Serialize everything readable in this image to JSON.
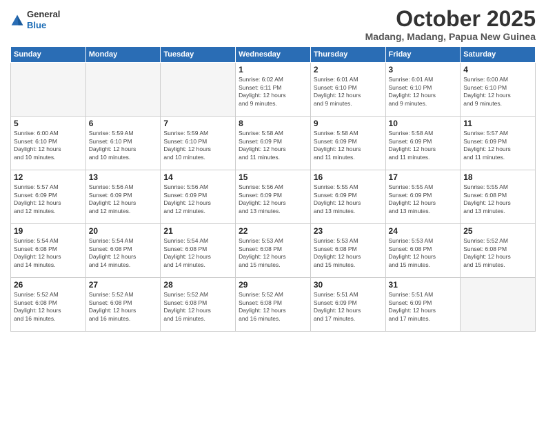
{
  "header": {
    "logo_general": "General",
    "logo_blue": "Blue",
    "month_title": "October 2025",
    "subtitle": "Madang, Madang, Papua New Guinea"
  },
  "weekdays": [
    "Sunday",
    "Monday",
    "Tuesday",
    "Wednesday",
    "Thursday",
    "Friday",
    "Saturday"
  ],
  "weeks": [
    [
      {
        "day": "",
        "info": ""
      },
      {
        "day": "",
        "info": ""
      },
      {
        "day": "",
        "info": ""
      },
      {
        "day": "1",
        "info": "Sunrise: 6:02 AM\nSunset: 6:11 PM\nDaylight: 12 hours\nand 9 minutes."
      },
      {
        "day": "2",
        "info": "Sunrise: 6:01 AM\nSunset: 6:10 PM\nDaylight: 12 hours\nand 9 minutes."
      },
      {
        "day": "3",
        "info": "Sunrise: 6:01 AM\nSunset: 6:10 PM\nDaylight: 12 hours\nand 9 minutes."
      },
      {
        "day": "4",
        "info": "Sunrise: 6:00 AM\nSunset: 6:10 PM\nDaylight: 12 hours\nand 9 minutes."
      }
    ],
    [
      {
        "day": "5",
        "info": "Sunrise: 6:00 AM\nSunset: 6:10 PM\nDaylight: 12 hours\nand 10 minutes."
      },
      {
        "day": "6",
        "info": "Sunrise: 5:59 AM\nSunset: 6:10 PM\nDaylight: 12 hours\nand 10 minutes."
      },
      {
        "day": "7",
        "info": "Sunrise: 5:59 AM\nSunset: 6:10 PM\nDaylight: 12 hours\nand 10 minutes."
      },
      {
        "day": "8",
        "info": "Sunrise: 5:58 AM\nSunset: 6:09 PM\nDaylight: 12 hours\nand 11 minutes."
      },
      {
        "day": "9",
        "info": "Sunrise: 5:58 AM\nSunset: 6:09 PM\nDaylight: 12 hours\nand 11 minutes."
      },
      {
        "day": "10",
        "info": "Sunrise: 5:58 AM\nSunset: 6:09 PM\nDaylight: 12 hours\nand 11 minutes."
      },
      {
        "day": "11",
        "info": "Sunrise: 5:57 AM\nSunset: 6:09 PM\nDaylight: 12 hours\nand 11 minutes."
      }
    ],
    [
      {
        "day": "12",
        "info": "Sunrise: 5:57 AM\nSunset: 6:09 PM\nDaylight: 12 hours\nand 12 minutes."
      },
      {
        "day": "13",
        "info": "Sunrise: 5:56 AM\nSunset: 6:09 PM\nDaylight: 12 hours\nand 12 minutes."
      },
      {
        "day": "14",
        "info": "Sunrise: 5:56 AM\nSunset: 6:09 PM\nDaylight: 12 hours\nand 12 minutes."
      },
      {
        "day": "15",
        "info": "Sunrise: 5:56 AM\nSunset: 6:09 PM\nDaylight: 12 hours\nand 13 minutes."
      },
      {
        "day": "16",
        "info": "Sunrise: 5:55 AM\nSunset: 6:09 PM\nDaylight: 12 hours\nand 13 minutes."
      },
      {
        "day": "17",
        "info": "Sunrise: 5:55 AM\nSunset: 6:09 PM\nDaylight: 12 hours\nand 13 minutes."
      },
      {
        "day": "18",
        "info": "Sunrise: 5:55 AM\nSunset: 6:08 PM\nDaylight: 12 hours\nand 13 minutes."
      }
    ],
    [
      {
        "day": "19",
        "info": "Sunrise: 5:54 AM\nSunset: 6:08 PM\nDaylight: 12 hours\nand 14 minutes."
      },
      {
        "day": "20",
        "info": "Sunrise: 5:54 AM\nSunset: 6:08 PM\nDaylight: 12 hours\nand 14 minutes."
      },
      {
        "day": "21",
        "info": "Sunrise: 5:54 AM\nSunset: 6:08 PM\nDaylight: 12 hours\nand 14 minutes."
      },
      {
        "day": "22",
        "info": "Sunrise: 5:53 AM\nSunset: 6:08 PM\nDaylight: 12 hours\nand 15 minutes."
      },
      {
        "day": "23",
        "info": "Sunrise: 5:53 AM\nSunset: 6:08 PM\nDaylight: 12 hours\nand 15 minutes."
      },
      {
        "day": "24",
        "info": "Sunrise: 5:53 AM\nSunset: 6:08 PM\nDaylight: 12 hours\nand 15 minutes."
      },
      {
        "day": "25",
        "info": "Sunrise: 5:52 AM\nSunset: 6:08 PM\nDaylight: 12 hours\nand 15 minutes."
      }
    ],
    [
      {
        "day": "26",
        "info": "Sunrise: 5:52 AM\nSunset: 6:08 PM\nDaylight: 12 hours\nand 16 minutes."
      },
      {
        "day": "27",
        "info": "Sunrise: 5:52 AM\nSunset: 6:08 PM\nDaylight: 12 hours\nand 16 minutes."
      },
      {
        "day": "28",
        "info": "Sunrise: 5:52 AM\nSunset: 6:08 PM\nDaylight: 12 hours\nand 16 minutes."
      },
      {
        "day": "29",
        "info": "Sunrise: 5:52 AM\nSunset: 6:08 PM\nDaylight: 12 hours\nand 16 minutes."
      },
      {
        "day": "30",
        "info": "Sunrise: 5:51 AM\nSunset: 6:09 PM\nDaylight: 12 hours\nand 17 minutes."
      },
      {
        "day": "31",
        "info": "Sunrise: 5:51 AM\nSunset: 6:09 PM\nDaylight: 12 hours\nand 17 minutes."
      },
      {
        "day": "",
        "info": ""
      }
    ]
  ]
}
